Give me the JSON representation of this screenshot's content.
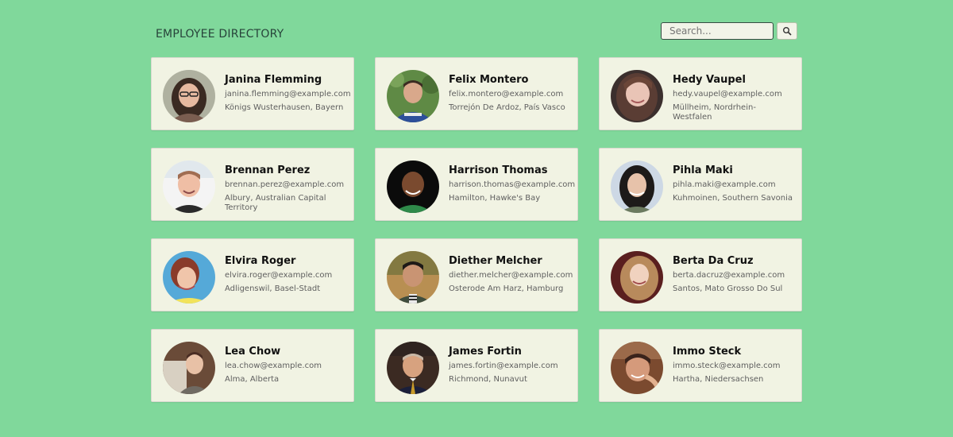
{
  "header": {
    "title": "EMPLOYEE DIRECTORY",
    "search_placeholder": "Search...",
    "search_button_icon": "search-icon"
  },
  "employees": [
    {
      "name": "Janina Flemming",
      "email": "janina.flemming@example.com",
      "location": "Königs Wusterhausen, Bayern",
      "avatar": "avatar-janina"
    },
    {
      "name": "Felix Montero",
      "email": "felix.montero@example.com",
      "location": "Torrejón De Ardoz, País Vasco",
      "avatar": "avatar-felix"
    },
    {
      "name": "Hedy Vaupel",
      "email": "hedy.vaupel@example.com",
      "location": "Müllheim, Nordrhein-Westfalen",
      "avatar": "avatar-hedy"
    },
    {
      "name": "Brennan Perez",
      "email": "brennan.perez@example.com",
      "location": "Albury, Australian Capital Territory",
      "avatar": "avatar-brennan"
    },
    {
      "name": "Harrison Thomas",
      "email": "harrison.thomas@example.com",
      "location": "Hamilton, Hawke's Bay",
      "avatar": "avatar-harrison"
    },
    {
      "name": "Pihla Maki",
      "email": "pihla.maki@example.com",
      "location": "Kuhmoinen, Southern Savonia",
      "avatar": "avatar-pihla"
    },
    {
      "name": "Elvira Roger",
      "email": "elvira.roger@example.com",
      "location": "Adligenswil, Basel-Stadt",
      "avatar": "avatar-elvira"
    },
    {
      "name": "Diether Melcher",
      "email": "diether.melcher@example.com",
      "location": "Osterode Am Harz, Hamburg",
      "avatar": "avatar-diether"
    },
    {
      "name": "Berta Da Cruz",
      "email": "berta.dacruz@example.com",
      "location": "Santos, Mato Grosso Do Sul",
      "avatar": "avatar-berta"
    },
    {
      "name": "Lea Chow",
      "email": "lea.chow@example.com",
      "location": "Alma, Alberta",
      "avatar": "avatar-lea"
    },
    {
      "name": "James Fortin",
      "email": "james.fortin@example.com",
      "location": "Richmond, Nunavut",
      "avatar": "avatar-james"
    },
    {
      "name": "Immo Steck",
      "email": "immo.steck@example.com",
      "location": "Hartha, Niedersachsen",
      "avatar": "avatar-immo"
    }
  ],
  "colors": {
    "background": "#80d89b",
    "card": "#f1f3e3",
    "title": "#27433a"
  }
}
